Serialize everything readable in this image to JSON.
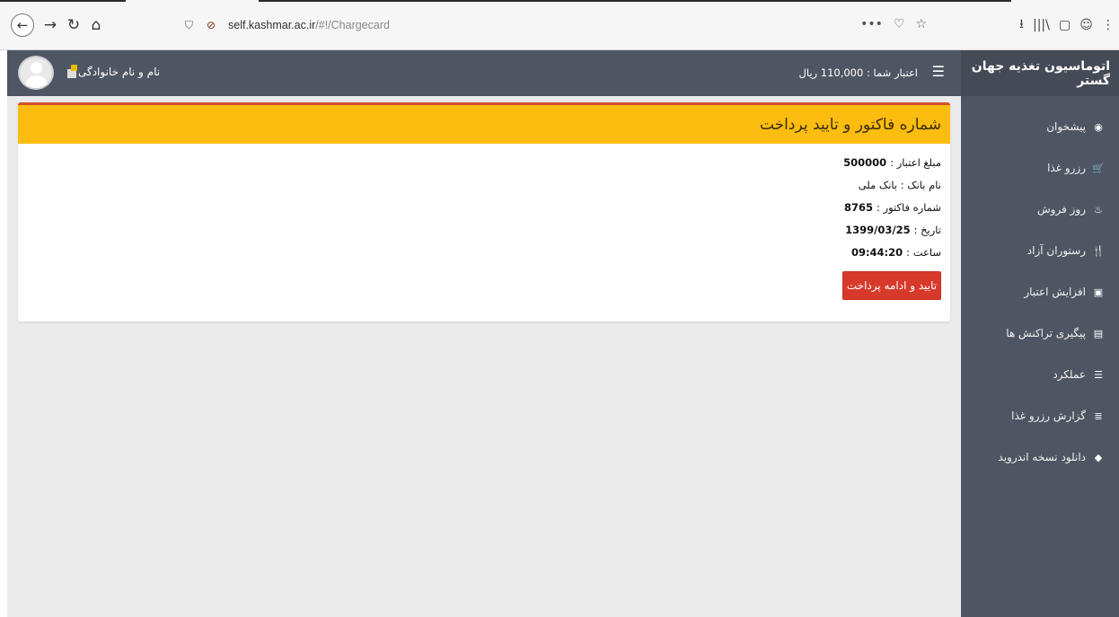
{
  "browser": {
    "url_host": "self.kashmar.ac.ir",
    "url_path": "/#!/Chargecard",
    "actions": [
      "•••",
      "♡",
      "☆"
    ],
    "tools": [
      "⭳",
      "|||\\",
      "▢",
      "☺",
      "⋮"
    ]
  },
  "app": {
    "brand": "اتوماسیون تغذیه جهان گستر",
    "credit_text": "اعتبار شما : 110,000 ریال",
    "user_name": "نام و نام خانوادگی"
  },
  "sidebar": {
    "items": [
      {
        "label": "پیشخوان",
        "icon": "dashboard-icon",
        "glyph": "◉"
      },
      {
        "label": "رزرو غذا",
        "icon": "cart-icon",
        "glyph": "🛒"
      },
      {
        "label": "روز فروش",
        "icon": "fire-icon",
        "glyph": "♨"
      },
      {
        "label": "رستوران آزاد",
        "icon": "cutlery-icon",
        "glyph": "🍴"
      },
      {
        "label": "افزایش اعتبار",
        "icon": "money-icon",
        "glyph": "▣"
      },
      {
        "label": "پیگیری تراکنش ها",
        "icon": "document-icon",
        "glyph": "▤"
      },
      {
        "label": "عملکرد",
        "icon": "list-icon",
        "glyph": "☰"
      },
      {
        "label": "گزارش رزرو غذا",
        "icon": "report-icon",
        "glyph": "≣"
      },
      {
        "label": "دانلود نسخه اندروید",
        "icon": "android-icon",
        "glyph": "◆"
      }
    ]
  },
  "card": {
    "title": "شماره فاکتور و تایید پرداخت",
    "lines": [
      {
        "key": "مبلغ اعتبار :",
        "value": "500000"
      },
      {
        "key": "نام بانک : بانک ملی",
        "value": ""
      },
      {
        "key": "شماره فاکتور :",
        "value": "8765"
      },
      {
        "key": "تاریخ :",
        "value": "1399/03/25"
      },
      {
        "key": "ساعت :",
        "value": "09:44:20"
      }
    ],
    "button_label": "تایید و ادامه پرداخت"
  },
  "colors": {
    "sidebar": "#4e5663",
    "card_header": "#fcbd10",
    "card_header_border": "#d64f28",
    "button": "#d73a2b"
  }
}
